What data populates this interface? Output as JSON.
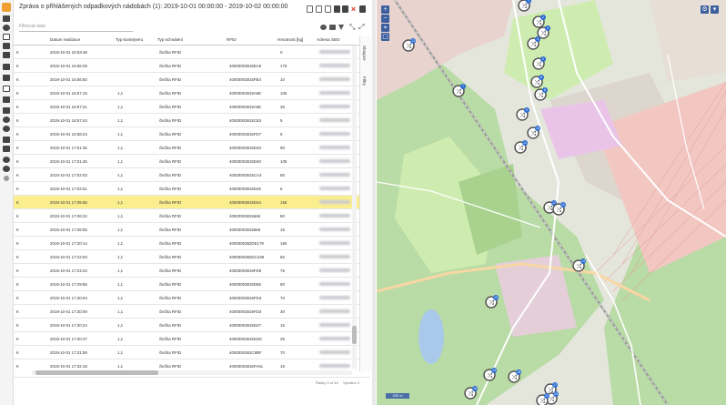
{
  "panel": {
    "title": "Zpráva o přihlášených odpadkových nádobách (1): 2019-10-01 00:00:00 - 2019-10-02 00:00:00",
    "filter_placeholder": "Filtrovat data",
    "columns": [
      "Datum realizace",
      "Typ kontejneru",
      "Typ schválení",
      "RFID",
      "Hmotnost [kg]",
      "Adresa SBO"
    ],
    "side_tabs": [
      "Sloupce",
      "Filtry"
    ],
    "footer_left": "Řádky 0 of 63",
    "footer_right": "Vybráno 0"
  },
  "rows": [
    {
      "date": "2019-10-01 16:53:48",
      "typ": "",
      "schv": "čtečka RFID",
      "rfid": "",
      "kg": "0",
      "hl": false
    },
    {
      "date": "2019-10-01 16:56:29",
      "typ": "",
      "schv": "čtečka RFID",
      "rfid": "40000003815EA6",
      "kg": "175",
      "hl": false
    },
    {
      "date": "2019-10-01 16:56:50",
      "typ": "",
      "schv": "čtečka RFID",
      "rfid": "40000003815FB4",
      "kg": "10",
      "hl": false
    },
    {
      "date": "2019-10-01 16:57:15",
      "typ": "1,1",
      "schv": "čtečka RFID",
      "rfid": "40000003819A5E",
      "kg": "105",
      "hl": false
    },
    {
      "date": "2019-10-01 16:57:21",
      "typ": "1,1",
      "schv": "čtečka RFID",
      "rfid": "40000003819A5E",
      "kg": "35",
      "hl": false
    },
    {
      "date": "2019-10-01 16:57:43",
      "typ": "1,1",
      "schv": "čtečka RFID",
      "rfid": "40000003815C83",
      "kg": "5",
      "hl": false
    },
    {
      "date": "2019-10-01 16:58:24",
      "typ": "1,1",
      "schv": "čtečka RFID",
      "rfid": "40000003815FD7",
      "kg": "5",
      "hl": false
    },
    {
      "date": "2019-10-01 17:01:35",
      "typ": "1,1",
      "schv": "čtečka RFID",
      "rfid": "40000003815D40",
      "kg": "90",
      "hl": false
    },
    {
      "date": "2019-10-01 17:01:45",
      "typ": "1,1",
      "schv": "čtečka RFID",
      "rfid": "40000003815D40",
      "kg": "105",
      "hl": false
    },
    {
      "date": "2019-10-01 17:02:03",
      "typ": "1,1",
      "schv": "čtečka RFID",
      "rfid": "40000003815CA3",
      "kg": "80",
      "hl": false
    },
    {
      "date": "2019-10-01 17:02:51",
      "typ": "1,1",
      "schv": "čtečka RFID",
      "rfid": "40000003815D45",
      "kg": "5",
      "hl": false
    },
    {
      "date": "2019-10-01 17:05:55",
      "typ": "1,1",
      "schv": "čtečka RFID",
      "rfid": "40000003815D44",
      "kg": "155",
      "hl": true
    },
    {
      "date": "2019-10-01 17:06:22",
      "typ": "1,1",
      "schv": "čtečka RFID",
      "rfid": "40000003815666",
      "kg": "80",
      "hl": false
    },
    {
      "date": "2019-10-01 17:06:55",
      "typ": "1,1",
      "schv": "čtečka RFID",
      "rfid": "40000003815666",
      "kg": "15",
      "hl": false
    },
    {
      "date": "2019-10-01 17:20:14",
      "typ": "1,1",
      "schv": "čtečka RFID",
      "rfid": "4000000382DE179",
      "kg": "160",
      "hl": false
    },
    {
      "date": "2019-10-01 17:22:03",
      "typ": "1,1",
      "schv": "čtečka RFID",
      "rfid": "4000000382DC438",
      "kg": "60",
      "hl": false
    },
    {
      "date": "2019-10-01 17:24:23",
      "typ": "1,1",
      "schv": "čtečka RFID",
      "rfid": "40000003819FD6",
      "kg": "75",
      "hl": false
    },
    {
      "date": "2019-10-01 17:29:55",
      "typ": "1,1",
      "schv": "čtečka RFID",
      "rfid": "40000003815D86",
      "kg": "90",
      "hl": false
    },
    {
      "date": "2019-10-01 17:30:04",
      "typ": "1,1",
      "schv": "čtečka RFID",
      "rfid": "40000003819FD3",
      "kg": "70",
      "hl": false
    },
    {
      "date": "2019-10-01 17:30:09",
      "typ": "1,1",
      "schv": "čtečka RFID",
      "rfid": "40000003819FD3",
      "kg": "30",
      "hl": false
    },
    {
      "date": "2019-10-01 17:30:24",
      "typ": "1,1",
      "schv": "čtečka RFID",
      "rfid": "40000003815D27",
      "kg": "15",
      "hl": false
    },
    {
      "date": "2019-10-01 17:30:47",
      "typ": "1,1",
      "schv": "čtečka RFID",
      "rfid": "40000003815D4D",
      "kg": "25",
      "hl": false
    },
    {
      "date": "2019-10-01 17:31:59",
      "typ": "1,1",
      "schv": "čtečka RFID",
      "rfid": "4000000381C8BF",
      "kg": "70",
      "hl": false
    },
    {
      "date": "2019-10-01 17:32:18",
      "typ": "1,1",
      "schv": "čtečka RFID",
      "rfid": "40000003815FA61",
      "kg": "15",
      "hl": false
    }
  ],
  "map": {
    "zoom_in": "+",
    "zoom_out": "−",
    "scale_label": "200 m",
    "marker_badges": [
      "1",
      "2",
      "3",
      "4",
      "5",
      "6",
      "7",
      "8",
      "9",
      "10",
      "11",
      "12",
      "13",
      "14",
      "15",
      "16",
      "17",
      "18",
      "19",
      "20",
      "21",
      "22"
    ],
    "colors": {
      "residential": "#e8c5c0",
      "forest": "#b9dba5",
      "grass": "#cfecb0",
      "road": "#ffffff",
      "water": "#a9c9ea",
      "marker_badge": "#2a6bd1"
    }
  }
}
